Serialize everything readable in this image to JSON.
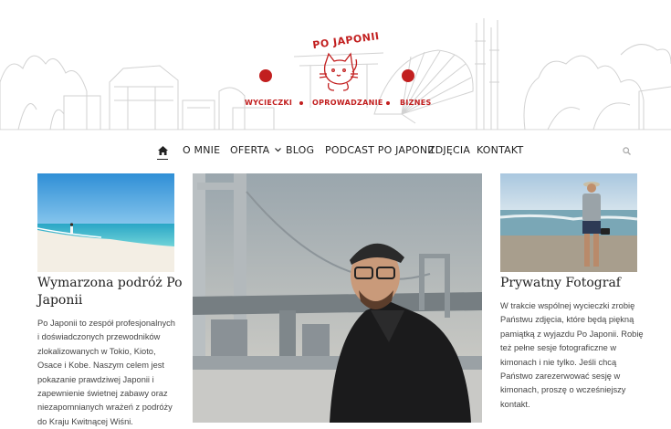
{
  "logo": {
    "title": "PO JAPONII"
  },
  "tagline": {
    "item1": "WYCIECZKI",
    "item2": "OPROWADZANIE",
    "item3": "BIZNES"
  },
  "nav": {
    "items": [
      "O MNIE",
      "OFERTA",
      "BLOG",
      "PODCAST PO JAPONII",
      "ZDJĘCIA",
      "KONTAKT"
    ]
  },
  "left_card": {
    "title_line1": "Wymarzona podróż Po",
    "title_line2": "Japonii",
    "text": [
      "Po Japonii to zespół profesjonalnych",
      "i doświadczonych przewodników",
      "zlokalizowanych w Tokio, Kioto,",
      "Osace i Kobe. Naszym celem jest",
      "pokazanie prawdziwej Japonii i",
      "zapewnienie świetnej zabawy oraz",
      "niezapomnianych wrażeń z podróży",
      "do Kraju Kwitnącej Wiśni."
    ]
  },
  "right_card": {
    "title": "Prywatny Fotograf",
    "text": [
      "W trakcie wspólnej wycieczki zrobię",
      "Państwu zdjęcia, które będą piękną",
      "pamiątką z wyjazdu Po Japonii. Robię",
      "też pełne sesje fotograficzne w",
      "kimonach i nie tylko. Jeśli chcą",
      "Państwo zarezerwować sesję w",
      "kimonach, proszę o wcześniejszy",
      "kontakt."
    ]
  },
  "colors": {
    "brand_red": "#c21f1f",
    "line_art": "#cfcfcf"
  },
  "icons": [
    "home-icon",
    "chevron-down-icon",
    "search-icon"
  ]
}
